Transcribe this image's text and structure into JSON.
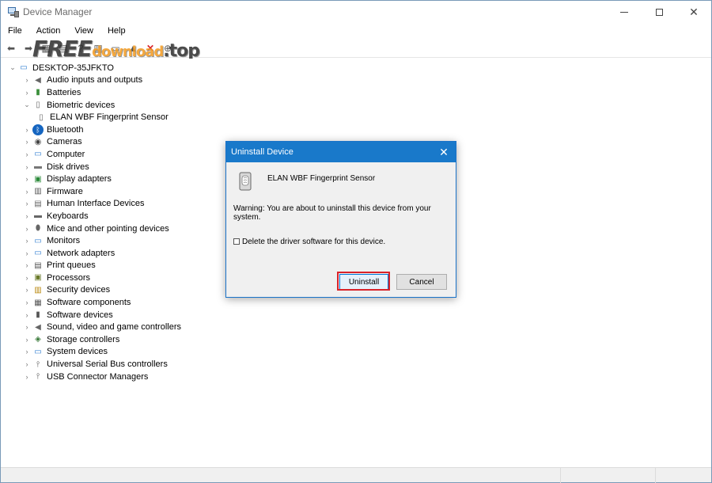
{
  "window": {
    "title": "Device Manager"
  },
  "menu": [
    "File",
    "Action",
    "View",
    "Help"
  ],
  "watermark": {
    "part1": "FREE",
    "part2": "download",
    "part3": ".top"
  },
  "tree": {
    "root": "DESKTOP-35JFKTO",
    "items": [
      {
        "label": "Audio inputs and outputs",
        "icon": "speaker-icon",
        "expanded": false
      },
      {
        "label": "Batteries",
        "icon": "battery-icon",
        "expanded": false
      },
      {
        "label": "Biometric devices",
        "icon": "fingerprint-icon",
        "expanded": true
      },
      {
        "label": "ELAN WBF Fingerprint Sensor",
        "icon": "fingerprint-icon",
        "child": true
      },
      {
        "label": "Bluetooth",
        "icon": "bluetooth-icon",
        "expanded": false
      },
      {
        "label": "Cameras",
        "icon": "camera-icon",
        "expanded": false
      },
      {
        "label": "Computer",
        "icon": "monitor-icon",
        "expanded": false
      },
      {
        "label": "Disk drives",
        "icon": "disk-icon",
        "expanded": false
      },
      {
        "label": "Display adapters",
        "icon": "display-adapter-icon",
        "expanded": false
      },
      {
        "label": "Firmware",
        "icon": "firmware-icon",
        "expanded": false
      },
      {
        "label": "Human Interface Devices",
        "icon": "hid-icon",
        "expanded": false
      },
      {
        "label": "Keyboards",
        "icon": "keyboard-icon",
        "expanded": false
      },
      {
        "label": "Mice and other pointing devices",
        "icon": "mouse-icon",
        "expanded": false
      },
      {
        "label": "Monitors",
        "icon": "monitor-icon",
        "expanded": false
      },
      {
        "label": "Network adapters",
        "icon": "network-icon",
        "expanded": false
      },
      {
        "label": "Print queues",
        "icon": "printer-icon",
        "expanded": false
      },
      {
        "label": "Processors",
        "icon": "processor-icon",
        "expanded": false
      },
      {
        "label": "Security devices",
        "icon": "security-icon",
        "expanded": false
      },
      {
        "label": "Software components",
        "icon": "software-component-icon",
        "expanded": false
      },
      {
        "label": "Software devices",
        "icon": "software-device-icon",
        "expanded": false
      },
      {
        "label": "Sound, video and game controllers",
        "icon": "speaker-icon",
        "expanded": false
      },
      {
        "label": "Storage controllers",
        "icon": "storage-icon",
        "expanded": false
      },
      {
        "label": "System devices",
        "icon": "system-icon",
        "expanded": false
      },
      {
        "label": "Universal Serial Bus controllers",
        "icon": "usb-icon",
        "expanded": false
      },
      {
        "label": "USB Connector Managers",
        "icon": "usb-icon",
        "expanded": false
      }
    ]
  },
  "dialog": {
    "title": "Uninstall Device",
    "device": "ELAN WBF Fingerprint Sensor",
    "warning": "Warning: You are about to uninstall this device from your system.",
    "checkbox_label": "Delete the driver software for this device.",
    "checkbox_checked": false,
    "uninstall_label": "Uninstall",
    "cancel_label": "Cancel"
  },
  "colors": {
    "accent": "#1979ca",
    "highlight": "#d9232a"
  }
}
